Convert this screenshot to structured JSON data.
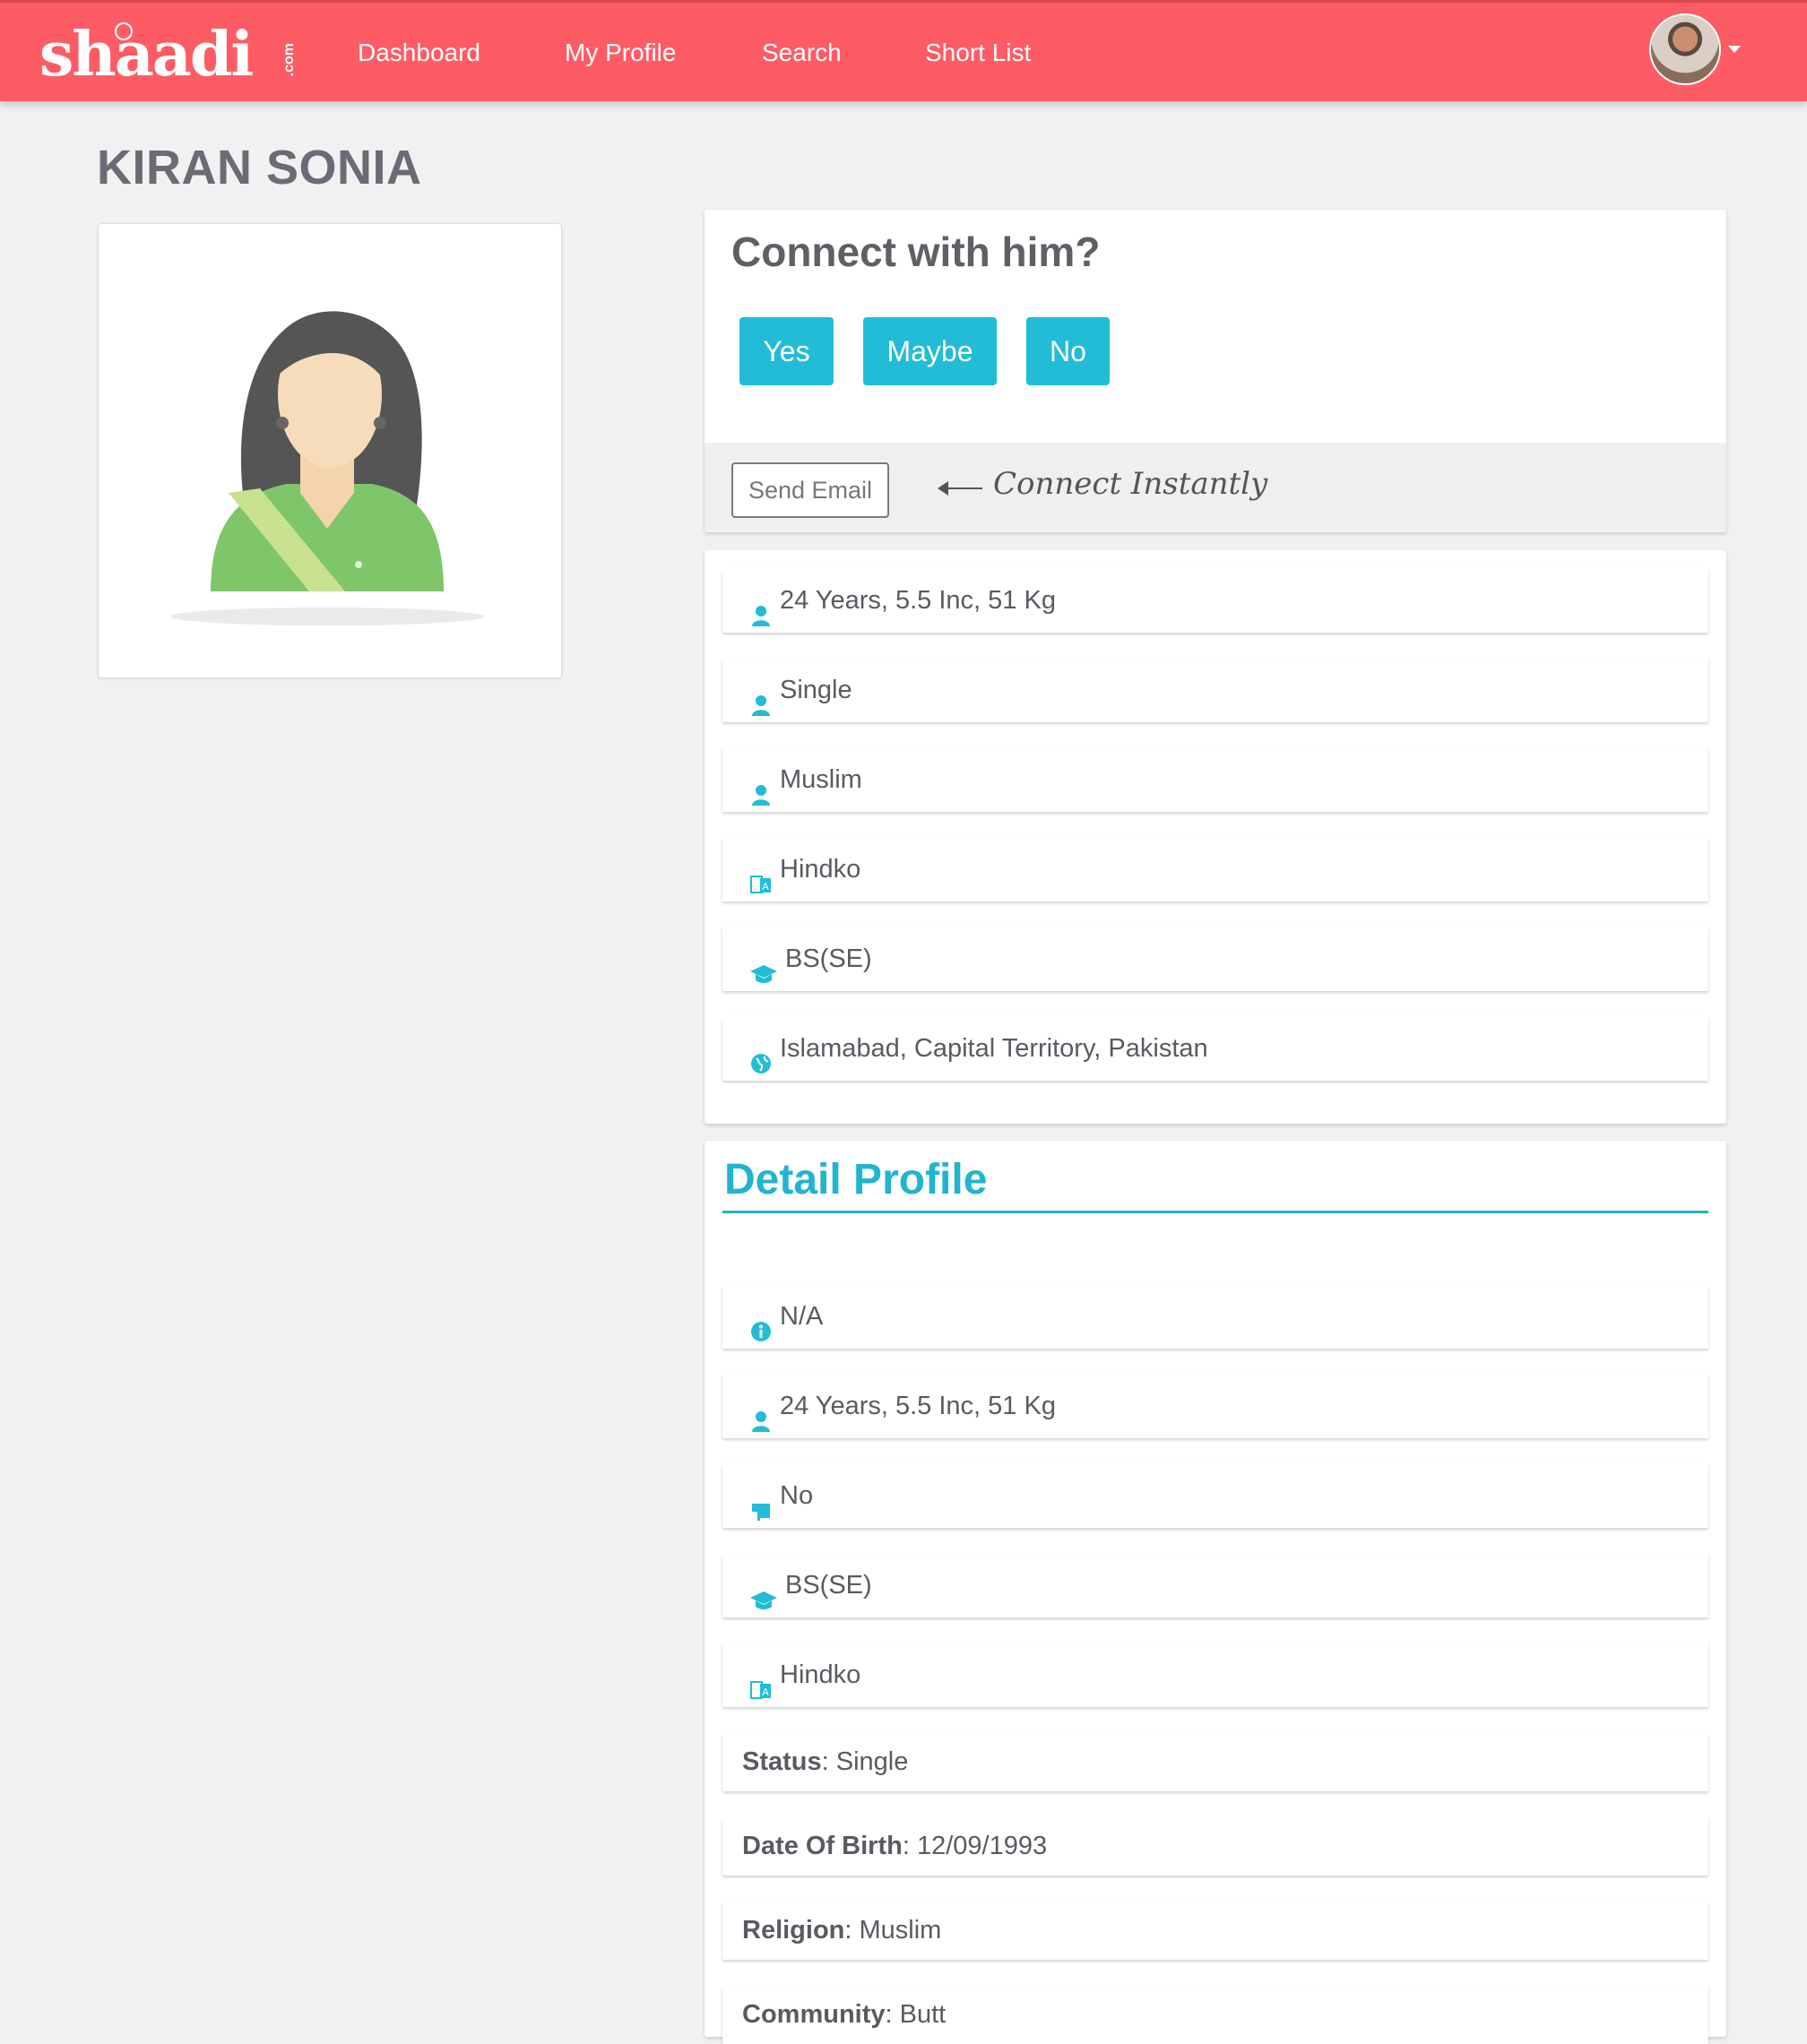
{
  "navbar": {
    "logo_text": "shaadi",
    "logo_suffix": ".com",
    "links": [
      "Dashboard",
      "My Profile",
      "Search",
      "Short List"
    ],
    "color": "#fd5c65"
  },
  "profile": {
    "name": "KIRAN SONIA"
  },
  "connect": {
    "title": "Connect with him?",
    "buttons": [
      "Yes",
      "Maybe",
      "No"
    ],
    "send_email_label": "Send Email",
    "hint": "Connect Instantly",
    "accent": "#22bcd6"
  },
  "summary": [
    {
      "icon": "user-icon",
      "text": "24 Years, 5.5 Inc, 51 Kg"
    },
    {
      "icon": "user-icon",
      "text": "Single"
    },
    {
      "icon": "user-icon",
      "text": "Muslim"
    },
    {
      "icon": "language-icon",
      "text": "Hindko"
    },
    {
      "icon": "graduation-cap-icon",
      "text": "BS(SE)"
    },
    {
      "icon": "globe-icon",
      "text": "Islamabad, Capital Territory, Pakistan"
    }
  ],
  "detail": {
    "title": "Detail Profile",
    "icon_rows": [
      {
        "icon": "info-icon",
        "text": "N/A"
      },
      {
        "icon": "user-icon",
        "text": "24 Years, 5.5 Inc, 51 Kg"
      },
      {
        "icon": "flag-icon",
        "text": "No"
      },
      {
        "icon": "graduation-cap-icon",
        "text": "BS(SE)"
      },
      {
        "icon": "language-icon",
        "text": "Hindko"
      }
    ],
    "labeled_rows": [
      {
        "label": "Status",
        "value": "Single"
      },
      {
        "label": "Date Of Birth",
        "value": "12/09/1993"
      },
      {
        "label": "Religion",
        "value": "Muslim"
      },
      {
        "label": "Community",
        "value": "Butt"
      }
    ]
  }
}
